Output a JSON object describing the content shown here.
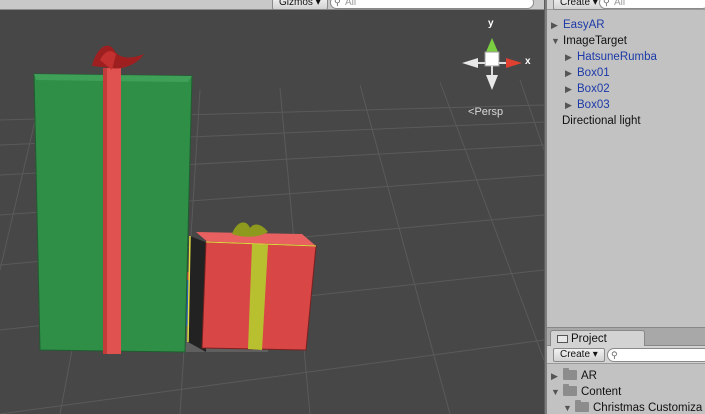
{
  "scene_toolbar": {
    "gizmos_label": "Gizmos ▾",
    "search_placeholder": "All"
  },
  "scene_gizmo": {
    "y_label": "y",
    "x_label": "x",
    "projection_label": "Persp"
  },
  "hierarchy": {
    "create_label": "Create ▾",
    "search_placeholder": "All",
    "items": [
      {
        "label": "EasyAR",
        "expanded": false,
        "depth": 0
      },
      {
        "label": "ImageTarget",
        "expanded": true,
        "depth": 0
      },
      {
        "label": "HatsuneRumba",
        "expanded": false,
        "depth": 1
      },
      {
        "label": "Box01",
        "expanded": false,
        "depth": 1
      },
      {
        "label": "Box02",
        "expanded": false,
        "depth": 1
      },
      {
        "label": "Box03",
        "expanded": false,
        "depth": 1
      },
      {
        "label": "Directional light",
        "expanded": false,
        "depth": 0
      }
    ]
  },
  "project": {
    "tab_label": "Project",
    "create_label": "Create ▾",
    "search_placeholder": "",
    "folders": [
      {
        "label": "AR",
        "expanded": false
      },
      {
        "label": "Content",
        "expanded": true
      },
      {
        "label": "Christmas Customiza",
        "expanded": true
      }
    ]
  },
  "colors": {
    "scene_background": "#474747",
    "green_box": "#2f8f47",
    "red_ribbon": "#e0524f",
    "red_box": "#d94646",
    "yellow_ribbon": "#b8c030",
    "hierarchy_link": "#1c3aa8"
  }
}
